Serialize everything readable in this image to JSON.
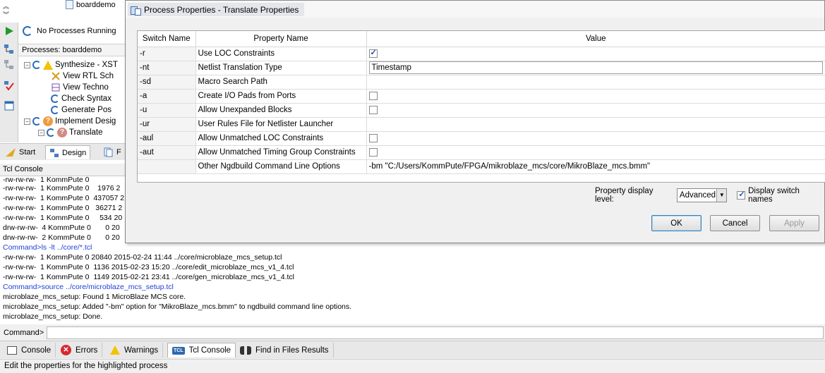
{
  "left": {
    "tree_top_item": "boarddemo",
    "status": "No Processes Running",
    "processes_header": "Processes: boarddemo",
    "tree": [
      {
        "label": "Synthesize - XST"
      },
      {
        "label": "View RTL Sch"
      },
      {
        "label": "View Techno"
      },
      {
        "label": "Check Syntax"
      },
      {
        "label": "Generate Pos"
      },
      {
        "label": "Implement Desig"
      },
      {
        "label": "Translate"
      }
    ],
    "tabs": [
      {
        "label": "Start"
      },
      {
        "label": "Design"
      },
      {
        "label": "F"
      }
    ]
  },
  "dialog": {
    "title": "Process Properties - Translate Properties",
    "columns": {
      "switch": "Switch Name",
      "property": "Property Name",
      "value": "Value"
    },
    "rows": [
      {
        "switch": "-r",
        "property": "Use LOC Constraints",
        "value_type": "checkbox",
        "checked": true
      },
      {
        "switch": "-nt",
        "property": "Netlist Translation Type",
        "value_type": "text",
        "value": "Timestamp"
      },
      {
        "switch": "-sd",
        "property": "Macro Search Path",
        "value_type": "empty"
      },
      {
        "switch": "-a",
        "property": "Create I/O Pads from Ports",
        "value_type": "checkbox",
        "checked": false
      },
      {
        "switch": "-u",
        "property": "Allow Unexpanded Blocks",
        "value_type": "checkbox",
        "checked": false
      },
      {
        "switch": "-ur",
        "property": "User Rules File for Netlister Launcher",
        "value_type": "empty"
      },
      {
        "switch": "-aul",
        "property": "Allow Unmatched LOC Constraints",
        "value_type": "checkbox",
        "checked": false
      },
      {
        "switch": "-aut",
        "property": "Allow Unmatched Timing Group Constraints",
        "value_type": "checkbox",
        "checked": false
      },
      {
        "switch": "",
        "property": "Other Ngdbuild Command Line Options",
        "value_type": "plain",
        "value": "-bm \"C:/Users/KommPute/FPGA/mikroblaze_mcs/core/MikroBlaze_mcs.bmm\""
      }
    ],
    "display_level_label": "Property display level:",
    "display_level_value": "Advanced",
    "display_switch_label": "Display switch names",
    "display_switch_checked": true,
    "buttons": {
      "ok": "OK",
      "cancel": "Cancel",
      "apply": "Apply"
    }
  },
  "tcl": {
    "header": "Tcl Console",
    "lines": [
      {
        "text": "-rw-rw-rw-  1 KommPute 0    1976 2",
        "kind": "out"
      },
      {
        "text": "-rw-rw-rw-  1 KommPute 0  437057 2",
        "kind": "out"
      },
      {
        "text": "-rw-rw-rw-  1 KommPute 0   36271 2",
        "kind": "out"
      },
      {
        "text": "-rw-rw-rw-  1 KommPute 0     534 20",
        "kind": "out"
      },
      {
        "text": "drw-rw-rw-  4 KommPute 0       0 20",
        "kind": "out"
      },
      {
        "text": "drw-rw-rw-  2 KommPute 0       0 20",
        "kind": "out"
      },
      {
        "text": "Command>ls -lt ../core/*.tcl",
        "kind": "cmd"
      },
      {
        "text": "-rw-rw-rw-  1 KommPute 0 20840 2015-02-24 11:44 ../core/microblaze_mcs_setup.tcl",
        "kind": "out"
      },
      {
        "text": "-rw-rw-rw-  1 KommPute 0  1136 2015-02-23 15:20 ../core/edit_microblaze_mcs_v1_4.tcl",
        "kind": "out"
      },
      {
        "text": "-rw-rw-rw-  1 KommPute 0  1149 2015-02-21 23:41 ../core/gen_microblaze_mcs_v1_4.tcl",
        "kind": "out"
      },
      {
        "text": "Command>source ../core/microblaze_mcs_setup.tcl",
        "kind": "cmd"
      },
      {
        "text": "microblaze_mcs_setup: Found 1 MicroBlaze MCS core.",
        "kind": "out"
      },
      {
        "text": "microblaze_mcs_setup: Added \"-bm\" option for \"MikroBlaze_mcs.bmm\" to ngdbuild command line options.",
        "kind": "out"
      },
      {
        "text": "microblaze_mcs_setup: Done.",
        "kind": "out"
      }
    ],
    "command_label": "Command>",
    "command_value": "",
    "tabs": [
      {
        "label": "Console"
      },
      {
        "label": "Errors"
      },
      {
        "label": "Warnings"
      },
      {
        "label": "Tcl Console"
      },
      {
        "label": "Find in Files Results"
      }
    ]
  },
  "status_bar": "Edit the properties for the highlighted process",
  "colors": {
    "command_text": "#1d3fd6",
    "error": "#d7282f",
    "warning": "#f2c300",
    "accent": "#2c6ab0"
  }
}
